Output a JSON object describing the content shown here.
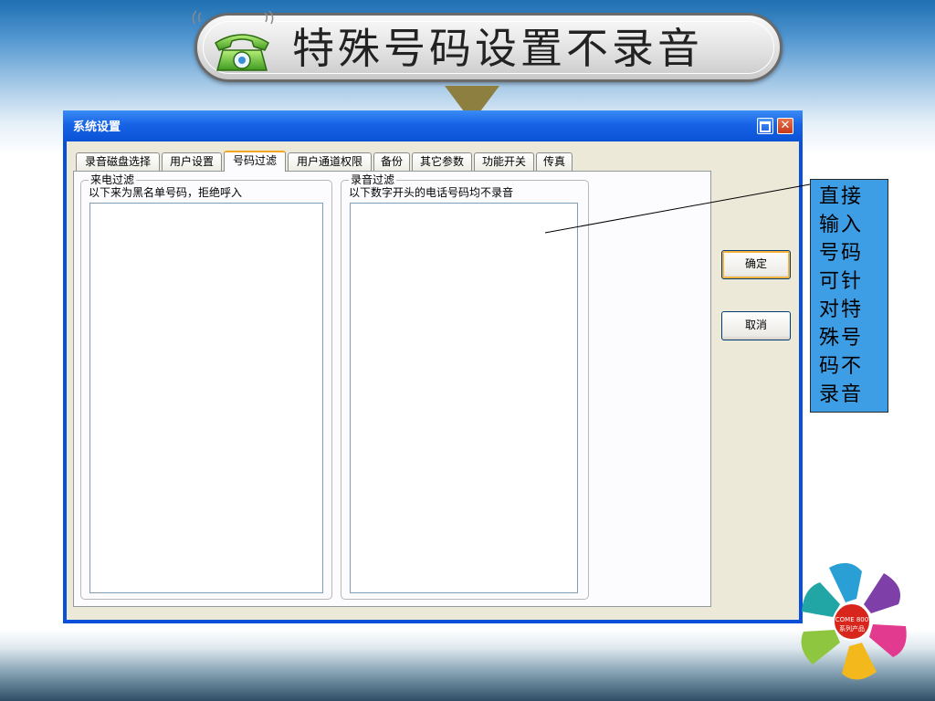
{
  "slide": {
    "title": "特殊号码设置不录音",
    "icon": "telephone-icon"
  },
  "dialog": {
    "title": "系统设置",
    "tabs": [
      "录音磁盘选择",
      "用户设置",
      "号码过滤",
      "用户通道权限",
      "备份",
      "其它参数",
      "功能开关",
      "传真"
    ],
    "active_tab": "号码过滤",
    "incoming_filter": {
      "title": "来电过滤",
      "description": "以下来为黑名单号码，拒绝呼入"
    },
    "record_filter": {
      "title": "录音过滤",
      "description": "以下数字开头的电话号码均不录音"
    },
    "ok_label": "确定",
    "cancel_label": "取消",
    "maximize_icon": "maximize-icon",
    "close_icon": "close-icon"
  },
  "callout": {
    "text": "直接输入号码可针对特殊号码不录音"
  },
  "logo": {
    "center_line1": "COME 800",
    "center_line2": "系列产品"
  },
  "colors": {
    "titlebar": "#0a52d6",
    "callout_bg": "#3d9de5",
    "arrow": "#8c7f3f",
    "default_button_highlight": "#f8b33c"
  }
}
